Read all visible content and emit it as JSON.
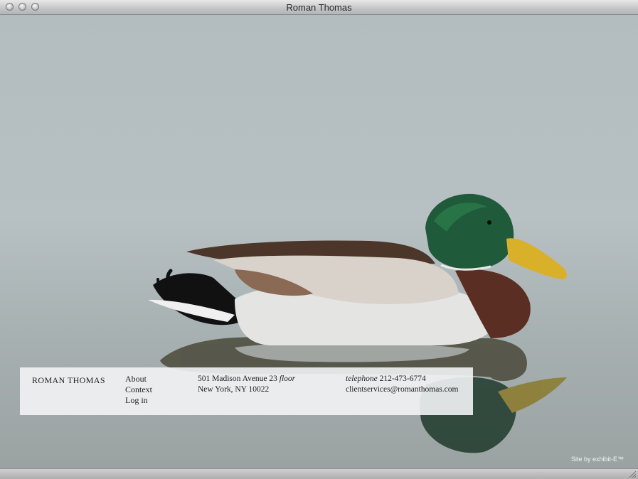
{
  "window": {
    "title": "Roman Thomas"
  },
  "brand": "ROMAN THOMAS",
  "nav": [
    {
      "label": "About"
    },
    {
      "label": "Context"
    },
    {
      "label": "Log in"
    }
  ],
  "address": {
    "line1": "501 Madison Avenue 23",
    "line1_italic": "floor",
    "line2": "New York, NY 10022"
  },
  "contact": {
    "phone_label": "telephone",
    "phone": "212-473-6774",
    "email": "clientservices@romanthomas.com"
  },
  "credit": "Site by exhibit-E™"
}
